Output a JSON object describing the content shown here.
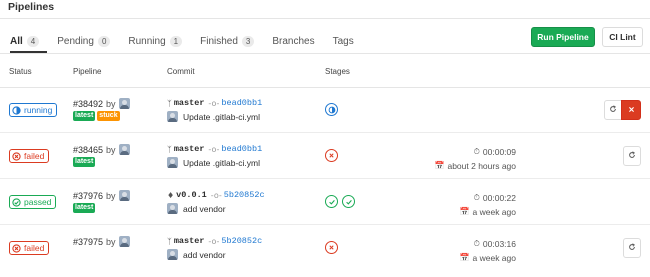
{
  "page": {
    "title": "Pipelines"
  },
  "tabs": [
    {
      "label": "All",
      "count": "4"
    },
    {
      "label": "Pending",
      "count": "0"
    },
    {
      "label": "Running",
      "count": "1"
    },
    {
      "label": "Finished",
      "count": "3"
    },
    {
      "label": "Branches"
    },
    {
      "label": "Tags"
    }
  ],
  "toolbar": {
    "run_pipeline": "Run Pipeline",
    "ci_lint": "CI Lint"
  },
  "columns": {
    "status": "Status",
    "pipeline": "Pipeline",
    "commit": "Commit",
    "stages": "Stages"
  },
  "colors": {
    "running": "#1f78d1",
    "failed": "#db3b21",
    "passed": "#1aaa55",
    "stuck": "#fc9403",
    "primary": "#1aaa55"
  },
  "rows": [
    {
      "status": "running",
      "id": "#38492",
      "by": "by",
      "labels": [
        "latest",
        "stuck"
      ],
      "branch": "master",
      "sha": "bead0bb1",
      "message": "Update .gitlab-ci.yml",
      "stages": [
        "running"
      ],
      "duration": "",
      "finished": "",
      "actions": [
        "retry",
        "cancel"
      ]
    },
    {
      "status": "failed",
      "id": "#38465",
      "by": "by",
      "labels": [
        "latest"
      ],
      "branch": "master",
      "sha": "bead0bb1",
      "message": "Update .gitlab-ci.yml",
      "stages": [
        "failed"
      ],
      "duration": "00:00:09",
      "finished": "about 2 hours ago",
      "actions": [
        "retry"
      ]
    },
    {
      "status": "passed",
      "id": "#37976",
      "by": "by",
      "labels": [
        "latest"
      ],
      "branch": "v0.0.1",
      "sha": "5b20852c",
      "message": "add vendor",
      "stages": [
        "passed",
        "passed"
      ],
      "duration": "00:00:22",
      "finished": "a week ago",
      "actions": []
    },
    {
      "status": "failed",
      "id": "#37975",
      "by": "by",
      "labels": [],
      "branch": "master",
      "sha": "5b20852c",
      "message": "add vendor",
      "stages": [
        "failed"
      ],
      "duration": "00:03:16",
      "finished": "a week ago",
      "actions": [
        "retry"
      ]
    }
  ],
  "icons": {
    "branch": "branch-icon",
    "tag": "tag-icon",
    "commit": "commit-icon",
    "timer": "timer-icon",
    "calendar": "calendar-icon",
    "retry": "retry-icon",
    "cancel": "close-icon"
  }
}
